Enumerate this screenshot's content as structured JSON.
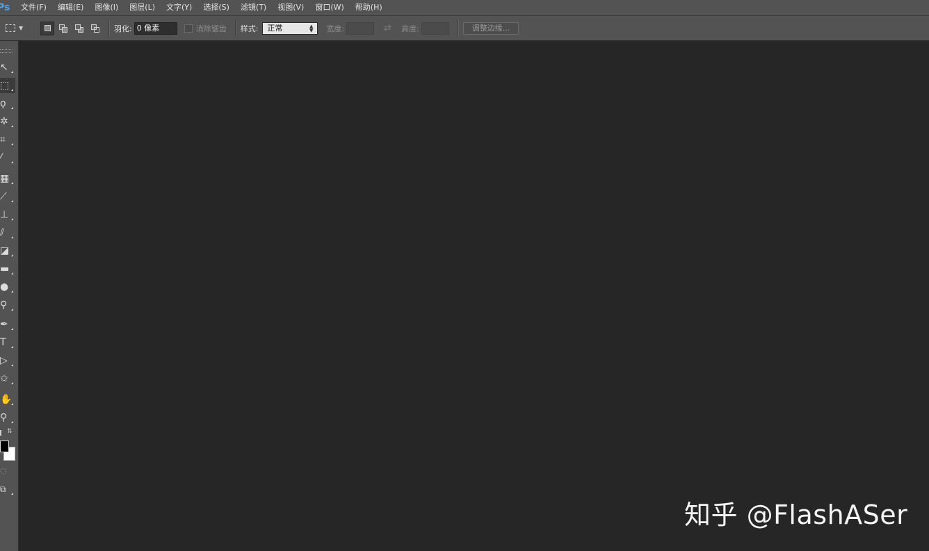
{
  "app": {
    "logo": "Ps"
  },
  "menu": [
    {
      "label": "文件(F)"
    },
    {
      "label": "编辑(E)"
    },
    {
      "label": "图像(I)"
    },
    {
      "label": "图层(L)"
    },
    {
      "label": "文字(Y)"
    },
    {
      "label": "选择(S)"
    },
    {
      "label": "滤镜(T)"
    },
    {
      "label": "视图(V)"
    },
    {
      "label": "窗口(W)"
    },
    {
      "label": "帮助(H)"
    }
  ],
  "options": {
    "feather_label": "羽化:",
    "feather_value": "0 像素",
    "antialias_label": "消除锯齿",
    "antialias_checked": false,
    "style_label": "样式:",
    "style_value": "正常",
    "width_label": "宽度:",
    "width_value": "",
    "height_label": "高度:",
    "height_value": "",
    "refine_edge_label": "调整边缘..."
  },
  "tools": [
    {
      "name": "move-tool",
      "glyph": "↖",
      "icon": "move-icon"
    },
    {
      "name": "rectangular-marquee-tool",
      "glyph": "⬚",
      "icon": "marquee-icon",
      "active": true
    },
    {
      "name": "lasso-tool",
      "glyph": "ϙ",
      "icon": "lasso-icon"
    },
    {
      "name": "magic-wand-tool",
      "glyph": "✲",
      "icon": "magic-wand-icon"
    },
    {
      "name": "crop-tool",
      "glyph": "⌗",
      "icon": "crop-icon"
    },
    {
      "name": "eyedropper-tool",
      "glyph": "⁄",
      "icon": "eyedropper-icon"
    },
    {
      "name": "healing-brush-tool",
      "glyph": "▦",
      "icon": "bandage-icon"
    },
    {
      "name": "brush-tool",
      "glyph": "⟋",
      "icon": "brush-icon"
    },
    {
      "name": "clone-stamp-tool",
      "glyph": "⊥",
      "icon": "stamp-icon"
    },
    {
      "name": "history-brush-tool",
      "glyph": "⫽",
      "icon": "history-brush-icon"
    },
    {
      "name": "eraser-tool",
      "glyph": "◪",
      "icon": "eraser-icon"
    },
    {
      "name": "gradient-tool",
      "glyph": "▬",
      "icon": "gradient-icon"
    },
    {
      "name": "blur-tool",
      "glyph": "●",
      "icon": "drop-icon"
    },
    {
      "name": "dodge-tool",
      "glyph": "⚲",
      "icon": "dodge-icon"
    },
    {
      "name": "pen-tool",
      "glyph": "✒",
      "icon": "pen-icon"
    },
    {
      "name": "type-tool",
      "glyph": "T",
      "icon": "type-icon"
    },
    {
      "name": "path-selection-tool",
      "glyph": "▷",
      "icon": "arrow-icon"
    },
    {
      "name": "custom-shape-tool",
      "glyph": "✩",
      "icon": "shape-icon"
    },
    {
      "name": "hand-tool",
      "glyph": "✋",
      "icon": "hand-icon"
    },
    {
      "name": "zoom-tool",
      "glyph": "⚲",
      "icon": "zoom-icon"
    }
  ],
  "colors": {
    "foreground": "#000000",
    "background": "#ffffff",
    "accent": "#4fa3e6",
    "chrome": "#535353",
    "workspace": "#262626"
  },
  "watermark": "知乎 @FlashASer"
}
